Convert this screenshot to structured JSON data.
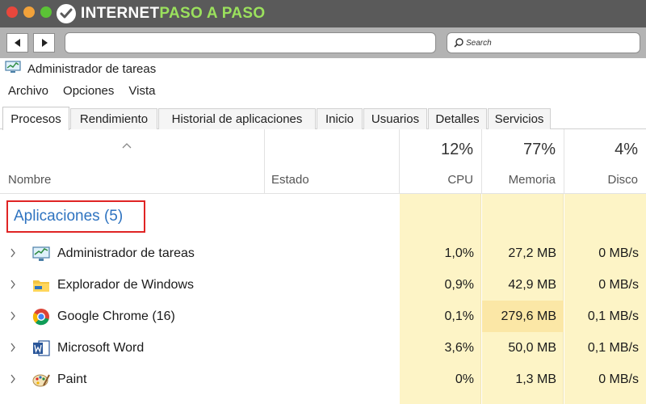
{
  "site": {
    "logo_part1": "INTERNET",
    "logo_part2": "PASO A PASO"
  },
  "browser": {
    "search_label": "Search",
    "back_icon": "arrow-left-icon",
    "forward_icon": "arrow-right-icon"
  },
  "window": {
    "title": "Administrador de tareas"
  },
  "menu": [
    "Archivo",
    "Opciones",
    "Vista"
  ],
  "tabs": [
    {
      "label": "Procesos",
      "active": true
    },
    {
      "label": "Rendimiento"
    },
    {
      "label": "Historial de aplicaciones"
    },
    {
      "label": "Inicio"
    },
    {
      "label": "Usuarios"
    },
    {
      "label": "Detalles"
    },
    {
      "label": "Servicios"
    }
  ],
  "columns": {
    "name": "Nombre",
    "status": "Estado",
    "cpu": {
      "pct": "12%",
      "label": "CPU"
    },
    "memory": {
      "pct": "77%",
      "label": "Memoria"
    },
    "disk": {
      "pct": "4%",
      "label": "Disco"
    }
  },
  "group": {
    "label": "Aplicaciones (5)"
  },
  "rows": [
    {
      "name": "Administrador de tareas",
      "icon": "task-manager-icon",
      "cpu": "1,0%",
      "mem": "27,2 MB",
      "disk": "0 MB/s"
    },
    {
      "name": "Explorador de Windows",
      "icon": "folder-icon",
      "cpu": "0,9%",
      "mem": "42,9 MB",
      "disk": "0 MB/s"
    },
    {
      "name": "Google Chrome (16)",
      "icon": "chrome-icon",
      "cpu": "0,1%",
      "mem": "279,6 MB",
      "disk": "0,1 MB/s"
    },
    {
      "name": "Microsoft Word",
      "icon": "word-icon",
      "cpu": "3,6%",
      "mem": "50,0 MB",
      "disk": "0,1 MB/s"
    },
    {
      "name": "Paint",
      "icon": "paint-icon",
      "cpu": "0%",
      "mem": "1,3 MB",
      "disk": "0 MB/s"
    }
  ],
  "colors": {
    "accent_blue": "#2e73c0",
    "highlight_red": "#e02424",
    "metric_bg": "#fdf4c6",
    "metric_hot": "#fbe7a6"
  }
}
